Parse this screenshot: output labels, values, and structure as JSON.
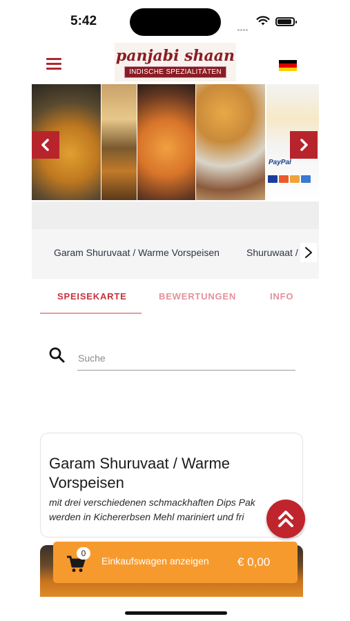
{
  "status_bar": {
    "time": "5:42"
  },
  "header": {
    "logo_title": "panjabi shaan",
    "logo_subtitle": "INDISCHE SPEZIALITÄTEN",
    "language_flag": "german-flag-icon"
  },
  "hero": {
    "paypal_text": "PayPal"
  },
  "categories": {
    "items": [
      {
        "label": "Garam Shuruvaat / Warme Vorspeisen"
      },
      {
        "label": "Shuruwaat /"
      }
    ]
  },
  "tabs": [
    {
      "label": "SPEISEKARTE",
      "active": true
    },
    {
      "label": "BEWERTUNGEN",
      "active": false
    },
    {
      "label": "INFO",
      "active": false
    }
  ],
  "search": {
    "placeholder": "Suche",
    "value": ""
  },
  "card": {
    "title": "Garam Shuruvaat / Warme Vorspeisen",
    "description_line1": "mit drei verschiedenen schmackhaften Dips Pak",
    "description_line2": "werden in Kichererbsen Mehl mariniert und fri"
  },
  "cart": {
    "count": "0",
    "label": "Einkaufswagen anzeigen",
    "total": "€ 0,00"
  },
  "colors": {
    "brand_red": "#c0242c",
    "cart_orange": "#f79a2e",
    "tab_active": "#c9303a",
    "tab_inactive": "#e5909a"
  }
}
